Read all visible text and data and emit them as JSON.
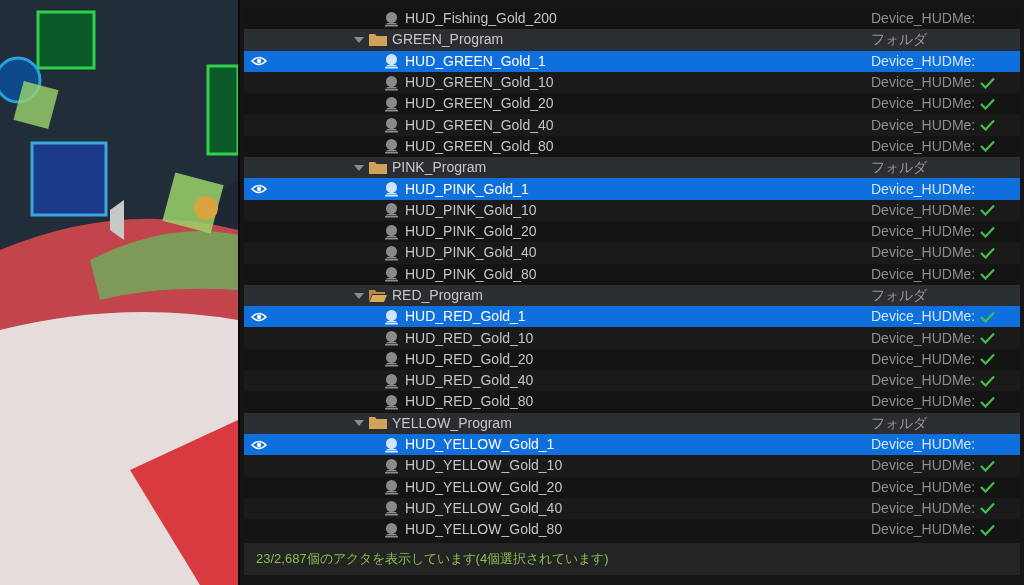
{
  "outliner": {
    "items": [
      {
        "kind": "folder_continued",
        "children": [
          {
            "kind": "actor",
            "name": "HUD_Fishing_Gold_200",
            "type": "Device_HUDMe:",
            "selected": false,
            "checked": false
          }
        ]
      },
      {
        "kind": "folder",
        "name": "GREEN_Program",
        "type": "フォルダ",
        "expanded": true,
        "open": false,
        "children": [
          {
            "kind": "actor",
            "name": "HUD_GREEN_Gold_1",
            "type": "Device_HUDMe:",
            "selected": true,
            "checked": false
          },
          {
            "kind": "actor",
            "name": "HUD_GREEN_Gold_10",
            "type": "Device_HUDMe:",
            "selected": false,
            "checked": true
          },
          {
            "kind": "actor",
            "name": "HUD_GREEN_Gold_20",
            "type": "Device_HUDMe:",
            "selected": false,
            "checked": true
          },
          {
            "kind": "actor",
            "name": "HUD_GREEN_Gold_40",
            "type": "Device_HUDMe:",
            "selected": false,
            "checked": true
          },
          {
            "kind": "actor",
            "name": "HUD_GREEN_Gold_80",
            "type": "Device_HUDMe:",
            "selected": false,
            "checked": true
          }
        ]
      },
      {
        "kind": "folder",
        "name": "PINK_Program",
        "type": "フォルダ",
        "expanded": true,
        "open": false,
        "children": [
          {
            "kind": "actor",
            "name": "HUD_PINK_Gold_1",
            "type": "Device_HUDMe:",
            "selected": true,
            "checked": false
          },
          {
            "kind": "actor",
            "name": "HUD_PINK_Gold_10",
            "type": "Device_HUDMe:",
            "selected": false,
            "checked": true
          },
          {
            "kind": "actor",
            "name": "HUD_PINK_Gold_20",
            "type": "Device_HUDMe:",
            "selected": false,
            "checked": true
          },
          {
            "kind": "actor",
            "name": "HUD_PINK_Gold_40",
            "type": "Device_HUDMe:",
            "selected": false,
            "checked": true
          },
          {
            "kind": "actor",
            "name": "HUD_PINK_Gold_80",
            "type": "Device_HUDMe:",
            "selected": false,
            "checked": true
          }
        ]
      },
      {
        "kind": "folder",
        "name": "RED_Program",
        "type": "フォルダ",
        "expanded": true,
        "open": true,
        "children": [
          {
            "kind": "actor",
            "name": "HUD_RED_Gold_1",
            "type": "Device_HUDMe:",
            "selected": true,
            "checked": true
          },
          {
            "kind": "actor",
            "name": "HUD_RED_Gold_10",
            "type": "Device_HUDMe:",
            "selected": false,
            "checked": true
          },
          {
            "kind": "actor",
            "name": "HUD_RED_Gold_20",
            "type": "Device_HUDMe:",
            "selected": false,
            "checked": true
          },
          {
            "kind": "actor",
            "name": "HUD_RED_Gold_40",
            "type": "Device_HUDMe:",
            "selected": false,
            "checked": true
          },
          {
            "kind": "actor",
            "name": "HUD_RED_Gold_80",
            "type": "Device_HUDMe:",
            "selected": false,
            "checked": true
          }
        ]
      },
      {
        "kind": "folder",
        "name": "YELLOW_Program",
        "type": "フォルダ",
        "expanded": true,
        "open": false,
        "children": [
          {
            "kind": "actor",
            "name": "HUD_YELLOW_Gold_1",
            "type": "Device_HUDMe:",
            "selected": true,
            "checked": false
          },
          {
            "kind": "actor",
            "name": "HUD_YELLOW_Gold_10",
            "type": "Device_HUDMe:",
            "selected": false,
            "checked": true
          },
          {
            "kind": "actor",
            "name": "HUD_YELLOW_Gold_20",
            "type": "Device_HUDMe:",
            "selected": false,
            "checked": true
          },
          {
            "kind": "actor",
            "name": "HUD_YELLOW_Gold_40",
            "type": "Device_HUDMe:",
            "selected": false,
            "checked": true
          },
          {
            "kind": "actor",
            "name": "HUD_YELLOW_Gold_80",
            "type": "Device_HUDMe:",
            "selected": false,
            "checked": true
          }
        ]
      }
    ]
  },
  "status_bar": "23/2,687個のアクタを表示しています(4個選択されています)"
}
